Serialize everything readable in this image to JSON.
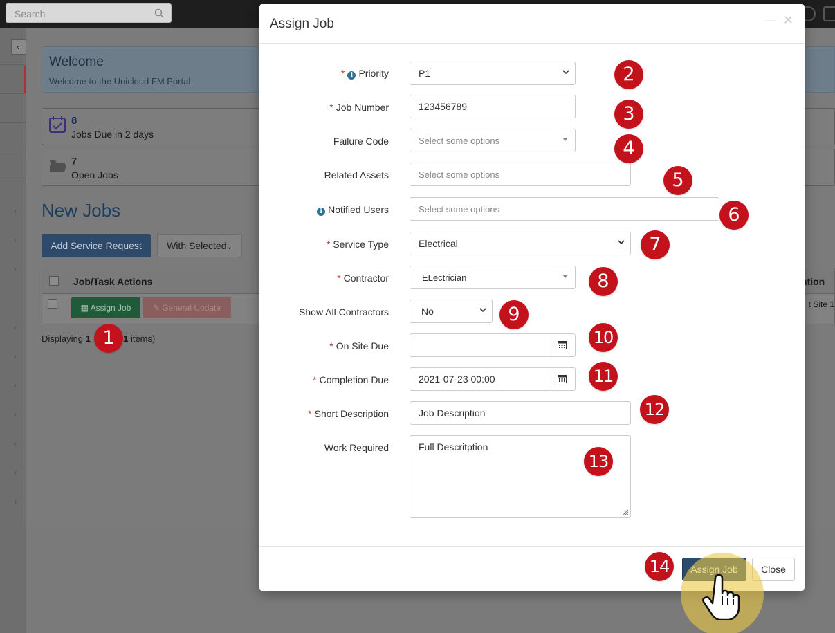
{
  "topbar": {
    "search_placeholder": "Search"
  },
  "welcome": {
    "title": "Welcome",
    "subtitle": "Welcome to the Unicloud FM Portal"
  },
  "stats": [
    {
      "value": "8",
      "label": "Jobs Due in 2 days"
    },
    {
      "value": "7",
      "label": "Open Jobs"
    }
  ],
  "jobs": {
    "title": "New Jobs",
    "add_button": "Add Service Request",
    "with_selected": "With Selected",
    "columns": [
      "Job/Task Actions",
      "cation"
    ],
    "row": {
      "assign": "Assign Job",
      "general_update": "General Update",
      "site": "t Site 1"
    },
    "displaying": {
      "prefix": "Displaying",
      "from": "1",
      "to": "1",
      "suffix": "items)"
    }
  },
  "modal": {
    "title": "Assign Job",
    "fields": {
      "priority": {
        "label": "Priority",
        "value": "P1"
      },
      "job_number": {
        "label": "Job Number",
        "value": "123456789"
      },
      "failure_code": {
        "label": "Failure Code",
        "placeholder": "Select some options"
      },
      "related_assets": {
        "label": "Related Assets",
        "placeholder": "Select some options"
      },
      "notified_users": {
        "label": "Notified Users",
        "placeholder": "Select some options"
      },
      "service_type": {
        "label": "Service Type",
        "value": "Electrical"
      },
      "contractor": {
        "label": "Contractor",
        "value": "ELectrician"
      },
      "show_all": {
        "label": "Show All Contractors",
        "value": "No"
      },
      "on_site_due": {
        "label": "On Site Due",
        "value": ""
      },
      "completion_due": {
        "label": "Completion Due",
        "value": "2021-07-23 00:00"
      },
      "short_description": {
        "label": "Short Description",
        "value": "Job Description"
      },
      "work_required": {
        "label": "Work Required",
        "value": "Full Descritption"
      }
    },
    "buttons": {
      "assign": "Assign Job",
      "close": "Close"
    }
  },
  "badges": [
    "1",
    "2",
    "3",
    "4",
    "5",
    "6",
    "7",
    "8",
    "9",
    "10",
    "11",
    "12",
    "13",
    "14"
  ],
  "colors": {
    "badge": "#c4121d",
    "primary": "#2a4b6d",
    "required": "#c0392b",
    "highlight": "#ebc846"
  }
}
